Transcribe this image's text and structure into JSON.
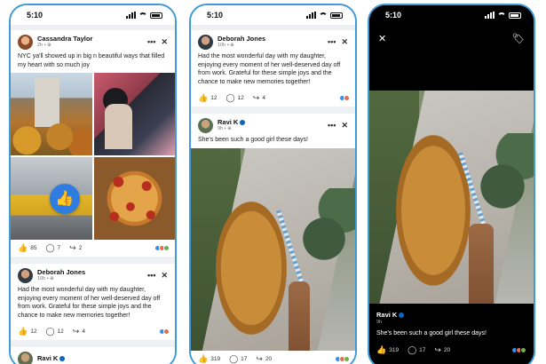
{
  "status_time": "5:10",
  "phone1": {
    "post1": {
      "author": "Cassandra Taylor",
      "meta": "2h • ⊕",
      "text": "NYC ya'll showed up in big n beautiful ways that filled my heart with so much joy",
      "likes": "85",
      "comments": "7",
      "shares": "2"
    },
    "post2": {
      "author": "Deborah Jones",
      "meta": "10h • ⊕",
      "text": "Had the most wonderful day with my daughter, enjoying every moment of her well-deserved day off from work. Grateful for these simple joys and the chance to make new memories together!",
      "likes": "12",
      "comments": "12",
      "shares": "4"
    },
    "post3": {
      "author": "Ravi K"
    }
  },
  "phone2": {
    "post1": {
      "author": "Deborah Jones",
      "meta": "10h • ⊕",
      "text": "Had the most wonderful day with my daughter, enjoying every moment of her well-deserved day off from work. Grateful for these simple joys and the chance to make new memories together!",
      "likes": "12",
      "comments": "12",
      "shares": "4"
    },
    "post2": {
      "author": "Ravi K",
      "meta": "9h • ⊕",
      "text": "She's been such a good girl these days!",
      "likes": "319",
      "comments": "17",
      "shares": "20"
    }
  },
  "phone3": {
    "author": "Ravi K",
    "meta": "9h",
    "text": "She's been such a good girl these days!",
    "likes": "319",
    "comments": "17",
    "shares": "20"
  },
  "icons": {
    "more": "•••",
    "close": "✕",
    "like": "👍",
    "comment": "◯",
    "share": "↪",
    "tag": "🏷"
  },
  "colors": {
    "frame": "#3f9ad8",
    "linkedin_blue": "#0a66c2",
    "like_badge": "#2f7de1",
    "react_like": "#378fe9",
    "react_love": "#df704d",
    "react_celebrate": "#6dae4f"
  }
}
